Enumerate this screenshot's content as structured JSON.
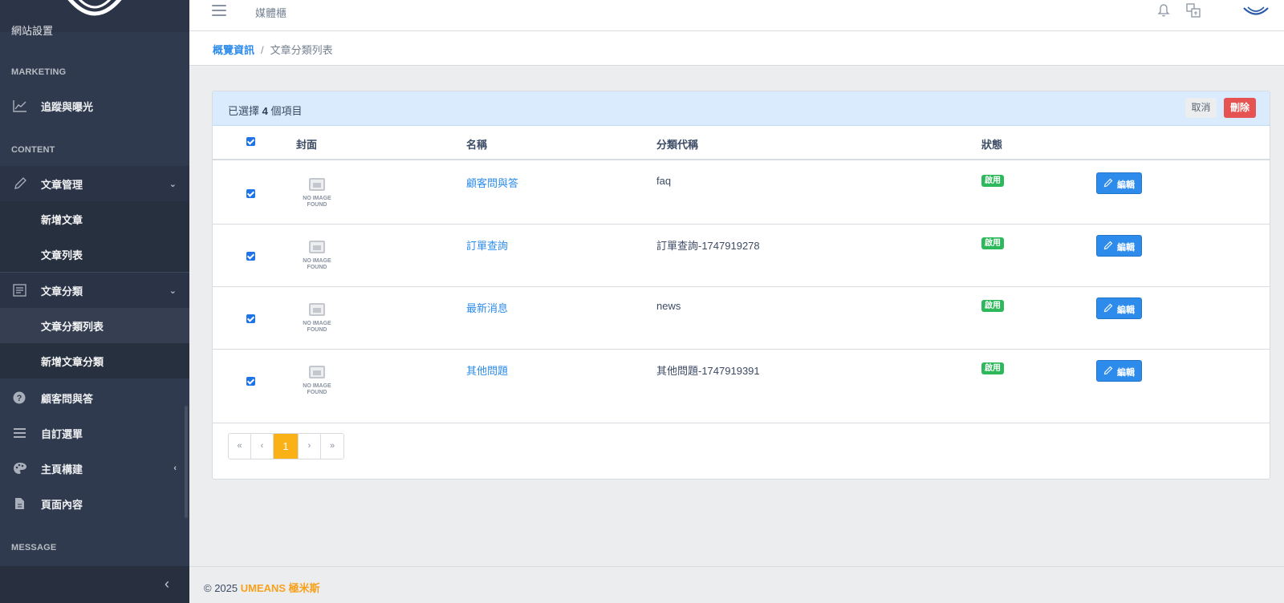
{
  "header": {
    "media_link": "媒體櫃"
  },
  "breadcrumb": {
    "home": "概覽資訊",
    "separator": "/",
    "current": "文章分類列表"
  },
  "sidebar": {
    "partial_item": "網站設置",
    "sections": {
      "marketing": "MARKETING",
      "content": "CONTENT",
      "message": "MESSAGE"
    },
    "items": {
      "tracking": "追蹤與曝光",
      "article_manage": "文章管理",
      "add_article": "新增文章",
      "article_list": "文章列表",
      "article_category": "文章分類",
      "category_list": "文章分類列表",
      "add_category": "新增文章分類",
      "faq": "顧客問與答",
      "custom_menu": "自訂選單",
      "homepage_builder": "主頁構建",
      "page_content": "頁面內容"
    }
  },
  "selection": {
    "prefix": "已選擇 ",
    "count": "4",
    "suffix": " 個項目",
    "cancel_label": "取消",
    "delete_label": "刪除"
  },
  "table": {
    "headers": {
      "cover": "封面",
      "name": "名稱",
      "code": "分類代稱",
      "status": "狀態"
    },
    "no_image_text": "NO IMAGE FOUND",
    "edit_label": "編輯",
    "rows": [
      {
        "name": "顧客問與答",
        "code": "faq",
        "status": "啟用",
        "checked": true
      },
      {
        "name": "訂單查詢",
        "code": "訂單查詢-1747919278",
        "status": "啟用",
        "checked": true
      },
      {
        "name": "最新消息",
        "code": "news",
        "status": "啟用",
        "checked": true
      },
      {
        "name": "其他問題",
        "code": "其他問題-1747919391",
        "status": "啟用",
        "checked": true
      }
    ]
  },
  "pagination": {
    "first": "«",
    "prev": "‹",
    "current": "1",
    "next": "›",
    "last": "»"
  },
  "footer": {
    "copyright": "© 2025 ",
    "brand": "UMEANS 極米斯"
  },
  "colors": {
    "primary": "#2d8ceb",
    "success": "#2eb85c",
    "danger": "#e55353",
    "warning": "#f9b115",
    "sidebar": "#2f3a4f"
  }
}
